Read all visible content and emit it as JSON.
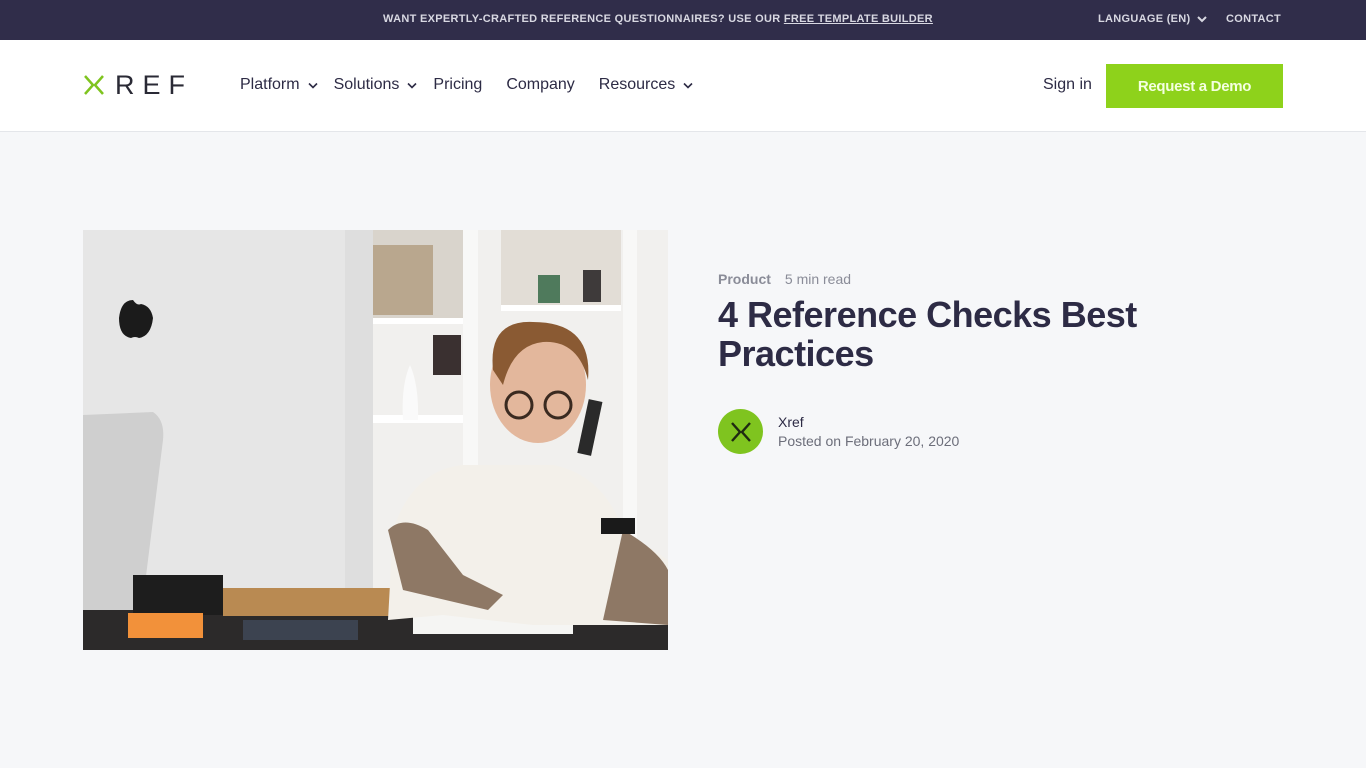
{
  "announcement": {
    "text": "WANT EXPERTLY-CRAFTED REFERENCE QUESTIONNAIRES? USE OUR ",
    "link_label": "FREE TEMPLATE BUILDER",
    "language_label": "LANGUAGE (EN)",
    "contact_label": "CONTACT"
  },
  "header": {
    "logo_text": "REF",
    "nav": [
      {
        "label": "Platform",
        "has_dropdown": true
      },
      {
        "label": "Solutions",
        "has_dropdown": true
      },
      {
        "label": "Pricing",
        "has_dropdown": false
      },
      {
        "label": "Company",
        "has_dropdown": false
      },
      {
        "label": "Resources",
        "has_dropdown": true
      }
    ],
    "signin_label": "Sign in",
    "demo_label": "Request a Demo"
  },
  "article": {
    "category": "Product",
    "read_time": "5 min read",
    "title": "4 Reference Checks Best Practices",
    "author_name": "Xref",
    "posted": "Posted on February 20, 2020",
    "image_alt": "Woman on phone writing notes at desk next to computer"
  },
  "colors": {
    "topbar_bg": "#302d4a",
    "accent_green": "#8ed21b",
    "page_bg": "#f6f7f9",
    "text_dark": "#2d2b45"
  }
}
